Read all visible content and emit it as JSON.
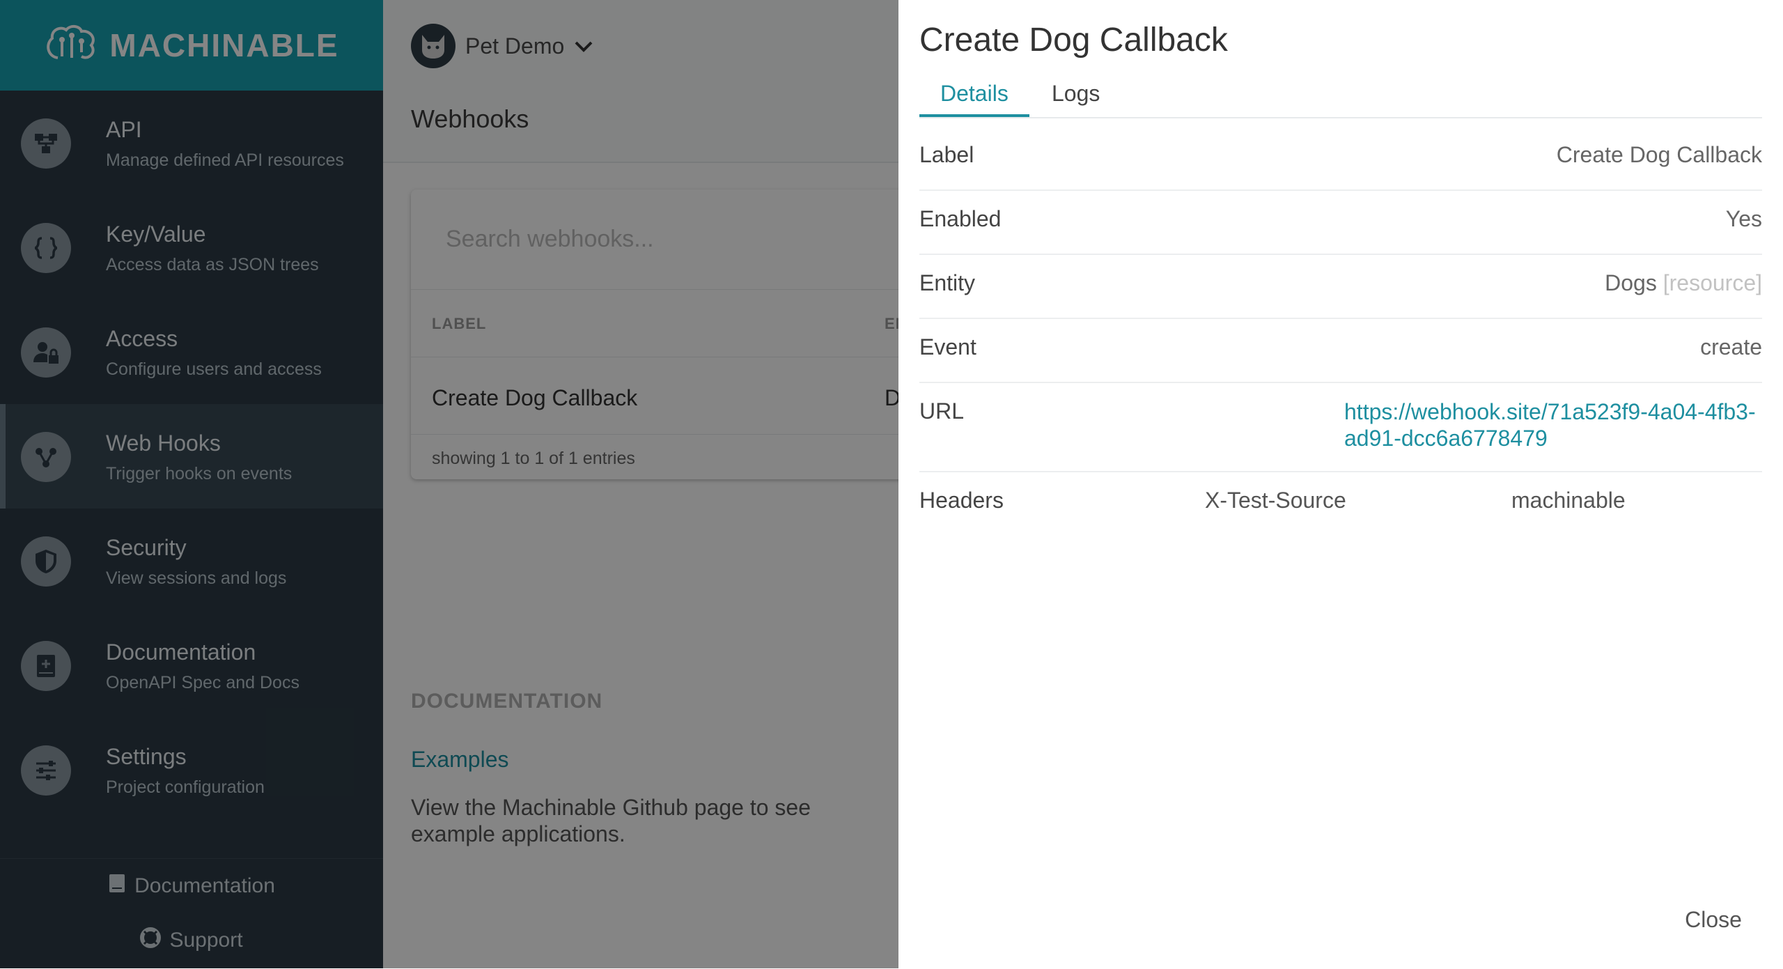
{
  "brand": {
    "name": "MACHINABLE"
  },
  "sidebar": {
    "items": [
      {
        "title": "API",
        "subtitle": "Manage defined API resources",
        "icon": "api-icon"
      },
      {
        "title": "Key/Value",
        "subtitle": "Access data as JSON trees",
        "icon": "braces-icon"
      },
      {
        "title": "Access",
        "subtitle": "Configure users and access",
        "icon": "user-lock-icon"
      },
      {
        "title": "Web Hooks",
        "subtitle": "Trigger hooks on events",
        "icon": "webhook-icon"
      },
      {
        "title": "Security",
        "subtitle": "View sessions and logs",
        "icon": "shield-icon"
      },
      {
        "title": "Documentation",
        "subtitle": "OpenAPI Spec and Docs",
        "icon": "book-plus-icon"
      },
      {
        "title": "Settings",
        "subtitle": "Project configuration",
        "icon": "sliders-icon"
      }
    ],
    "footer": {
      "documentation": "Documentation",
      "support": "Support"
    }
  },
  "project": {
    "name": "Pet Demo"
  },
  "page": {
    "title": "Webhooks"
  },
  "table": {
    "search_placeholder": "Search webhooks...",
    "columns": [
      "LABEL",
      "ENTITY"
    ],
    "rows": [
      {
        "label": "Create Dog Callback",
        "entity": "Dogs"
      }
    ],
    "entries_text": "showing 1 to 1 of 1 entries"
  },
  "documentation": {
    "heading": "DOCUMENTATION",
    "link": "Examples",
    "text": "View the Machinable Github page to see example applications."
  },
  "drawer": {
    "title": "Create Dog Callback",
    "tabs": [
      "Details",
      "Logs"
    ],
    "fields": {
      "label": {
        "name": "Label",
        "value": "Create Dog Callback"
      },
      "enabled": {
        "name": "Enabled",
        "value": "Yes"
      },
      "entity": {
        "name": "Entity",
        "value": "Dogs",
        "tag": "[resource]"
      },
      "event": {
        "name": "Event",
        "value": "create"
      },
      "url": {
        "name": "URL",
        "value": "https://webhook.site/71a523f9-4a04-4fb3-ad91-dcc6a6778479"
      },
      "headers": {
        "name": "Headers",
        "key": "X-Test-Source",
        "value": "machinable"
      }
    },
    "close_label": "Close"
  },
  "colors": {
    "accent": "#17a2b0",
    "link": "#1e8fa0",
    "sidebar_bg": "#2d3b45"
  }
}
